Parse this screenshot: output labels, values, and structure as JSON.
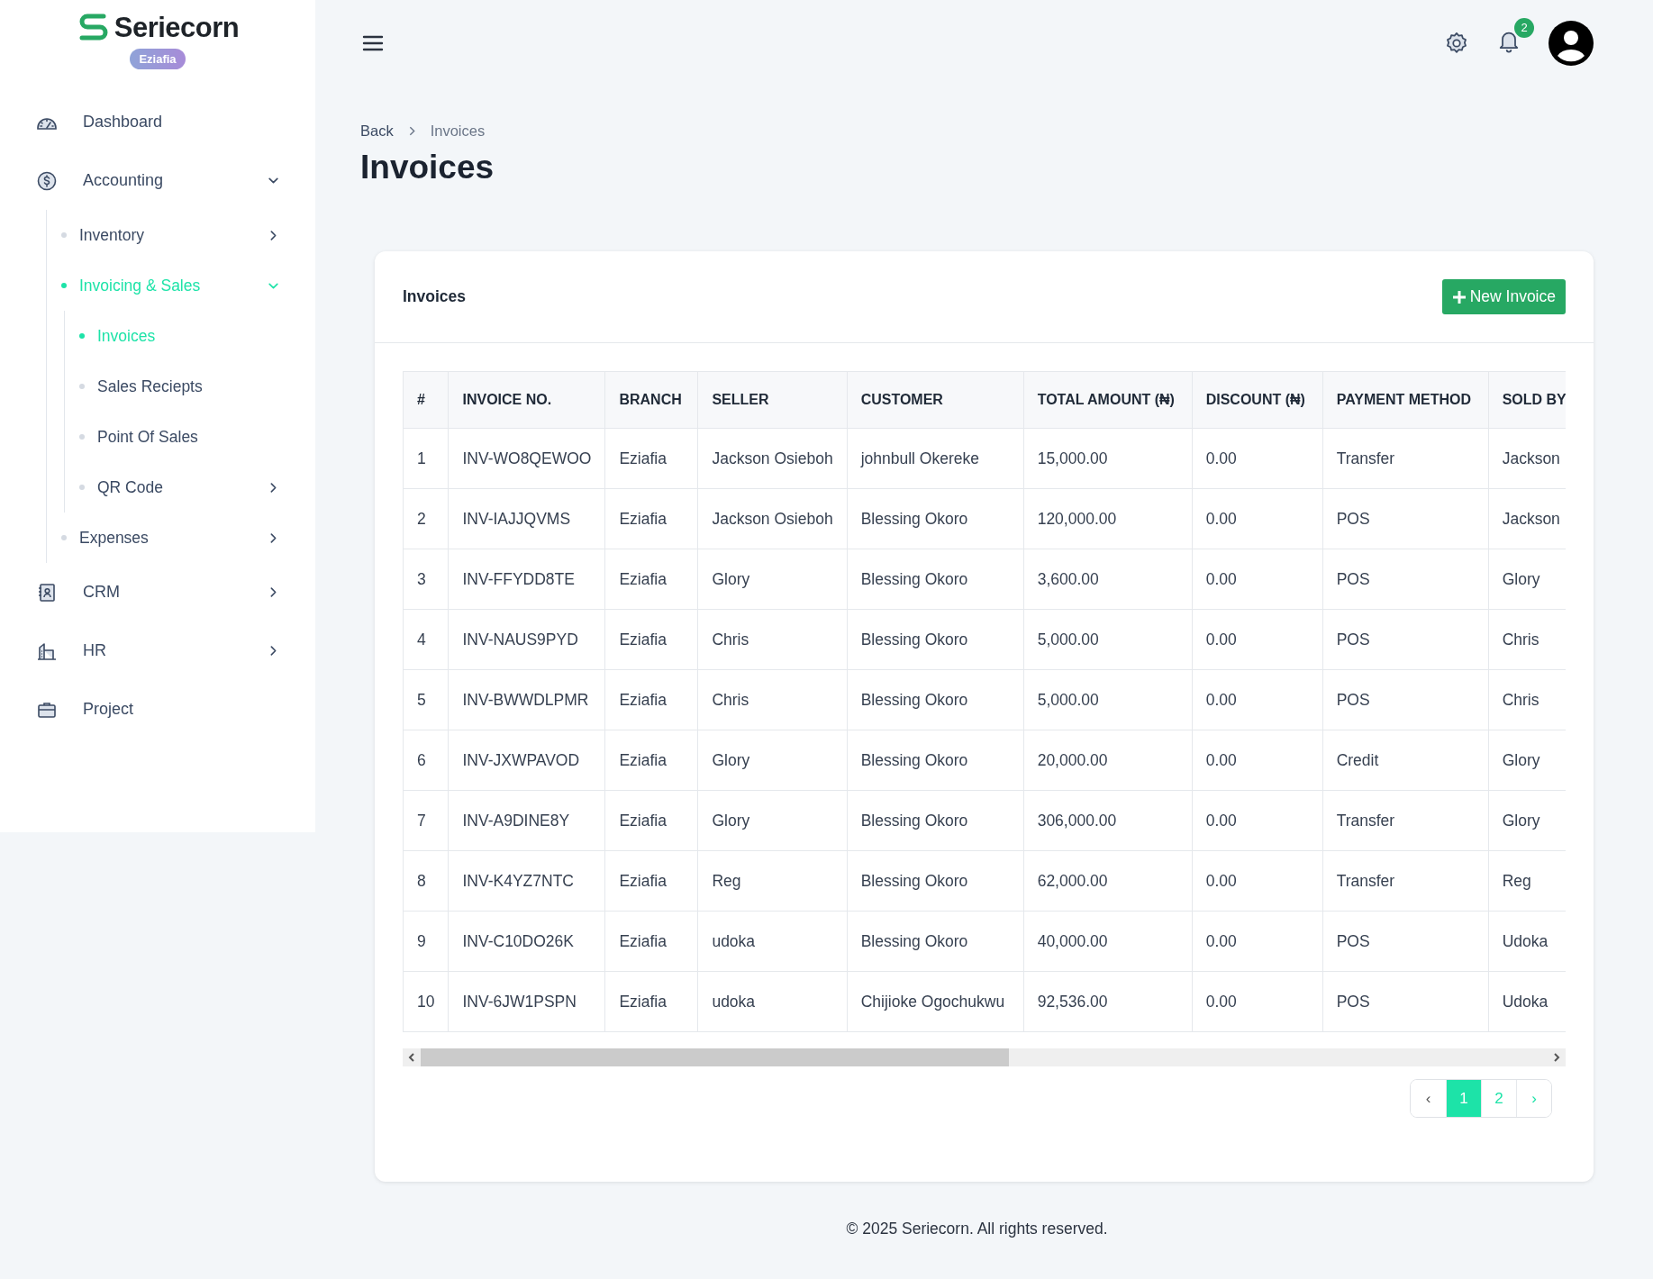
{
  "brand": {
    "name": "Seriecorn",
    "badge": "Eziafia"
  },
  "sidebar": {
    "items": [
      {
        "label": "Dashboard",
        "selected": false
      },
      {
        "label": "Accounting",
        "selected": false,
        "expanded": true,
        "children": [
          {
            "label": "Inventory",
            "selected": false,
            "expanded": false
          },
          {
            "label": "Invoicing & Sales",
            "selected": true,
            "expanded": true,
            "children": [
              {
                "label": "Invoices",
                "selected": true
              },
              {
                "label": "Sales Reciepts",
                "selected": false
              },
              {
                "label": "Point Of Sales",
                "selected": false
              },
              {
                "label": "QR Code",
                "selected": false,
                "expanded": false
              }
            ]
          },
          {
            "label": "Expenses",
            "selected": false,
            "expanded": false
          }
        ]
      },
      {
        "label": "CRM",
        "selected": false,
        "expanded": false
      },
      {
        "label": "HR",
        "selected": false,
        "expanded": false
      },
      {
        "label": "Project",
        "selected": false
      }
    ]
  },
  "header": {
    "notifications": "2"
  },
  "breadcrumb": {
    "back": "Back",
    "current": "Invoices"
  },
  "page_title": "Invoices",
  "card": {
    "title": "Invoices",
    "new_button": "New Invoice",
    "table": {
      "columns": [
        "#",
        "INVOICE NO.",
        "BRANCH",
        "SELLER",
        "CUSTOMER",
        "TOTAL AMOUNT (₦)",
        "DISCOUNT (₦)",
        "PAYMENT METHOD",
        "SOLD BY"
      ],
      "rows": [
        [
          "1",
          "INV-WO8QEWOO",
          "Eziafia",
          "Jackson Osieboh",
          "johnbull Okereke",
          "15,000.00",
          "0.00",
          "Transfer",
          "Jackson"
        ],
        [
          "2",
          "INV-IAJJQVMS",
          "Eziafia",
          "Jackson Osieboh",
          "Blessing Okoro",
          "120,000.00",
          "0.00",
          "POS",
          "Jackson"
        ],
        [
          "3",
          "INV-FFYDD8TE",
          "Eziafia",
          "Glory",
          "Blessing Okoro",
          "3,600.00",
          "0.00",
          "POS",
          "Glory"
        ],
        [
          "4",
          "INV-NAUS9PYD",
          "Eziafia",
          "Chris",
          "Blessing Okoro",
          "5,000.00",
          "0.00",
          "POS",
          "Chris"
        ],
        [
          "5",
          "INV-BWWDLPMR",
          "Eziafia",
          "Chris",
          "Blessing Okoro",
          "5,000.00",
          "0.00",
          "POS",
          "Chris"
        ],
        [
          "6",
          "INV-JXWPAVOD",
          "Eziafia",
          "Glory",
          "Blessing Okoro",
          "20,000.00",
          "0.00",
          "Credit",
          "Glory"
        ],
        [
          "7",
          "INV-A9DINE8Y",
          "Eziafia",
          "Glory",
          "Blessing Okoro",
          "306,000.00",
          "0.00",
          "Transfer",
          "Glory"
        ],
        [
          "8",
          "INV-K4YZ7NTC",
          "Eziafia",
          "Reg",
          "Blessing Okoro",
          "62,000.00",
          "0.00",
          "Transfer",
          "Reg"
        ],
        [
          "9",
          "INV-C10DO26K",
          "Eziafia",
          "udoka",
          "Blessing Okoro",
          "40,000.00",
          "0.00",
          "POS",
          "Udoka"
        ],
        [
          "10",
          "INV-6JW1PSPN",
          "Eziafia",
          "udoka",
          "Chijioke Ogochukwu",
          "92,536.00",
          "0.00",
          "POS",
          "Udoka"
        ]
      ]
    },
    "pagination": {
      "prev": "‹",
      "next": "›",
      "pages": [
        {
          "label": "1",
          "selected": true
        },
        {
          "label": "2",
          "selected": false
        }
      ]
    }
  },
  "footer": "© 2025 Seriecorn. All rights reserved."
}
